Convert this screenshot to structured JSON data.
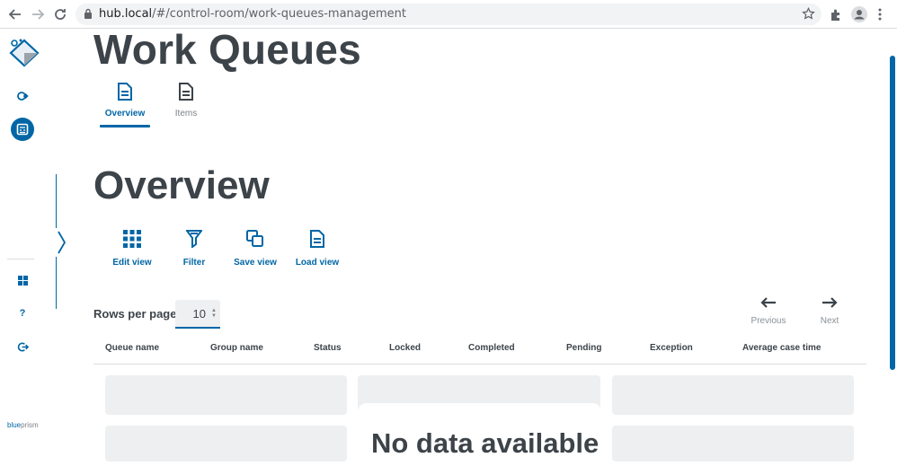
{
  "browser": {
    "url_host": "hub.local",
    "url_path": "/#/control-room/work-queues-management"
  },
  "page": {
    "title": "Work Queues",
    "tabs": [
      {
        "label": "Overview",
        "active": true
      },
      {
        "label": "Items",
        "active": false
      }
    ],
    "section_title": "Overview"
  },
  "toolbar": {
    "edit_view": "Edit view",
    "filter": "Filter",
    "save_view": "Save view",
    "load_view": "Load view"
  },
  "pagination": {
    "rows_label": "Rows per page",
    "rows_value": "10",
    "previous": "Previous",
    "next": "Next"
  },
  "table": {
    "columns": [
      "Queue name",
      "Group name",
      "Status",
      "Locked",
      "Completed",
      "Pending",
      "Exception",
      "Average case time"
    ],
    "empty_message": "No data available"
  },
  "brand": {
    "part1": "blue",
    "part2": "prism"
  },
  "colors": {
    "accent": "#0066a6",
    "text": "#3c4349",
    "placeholder": "#eeeff1"
  }
}
